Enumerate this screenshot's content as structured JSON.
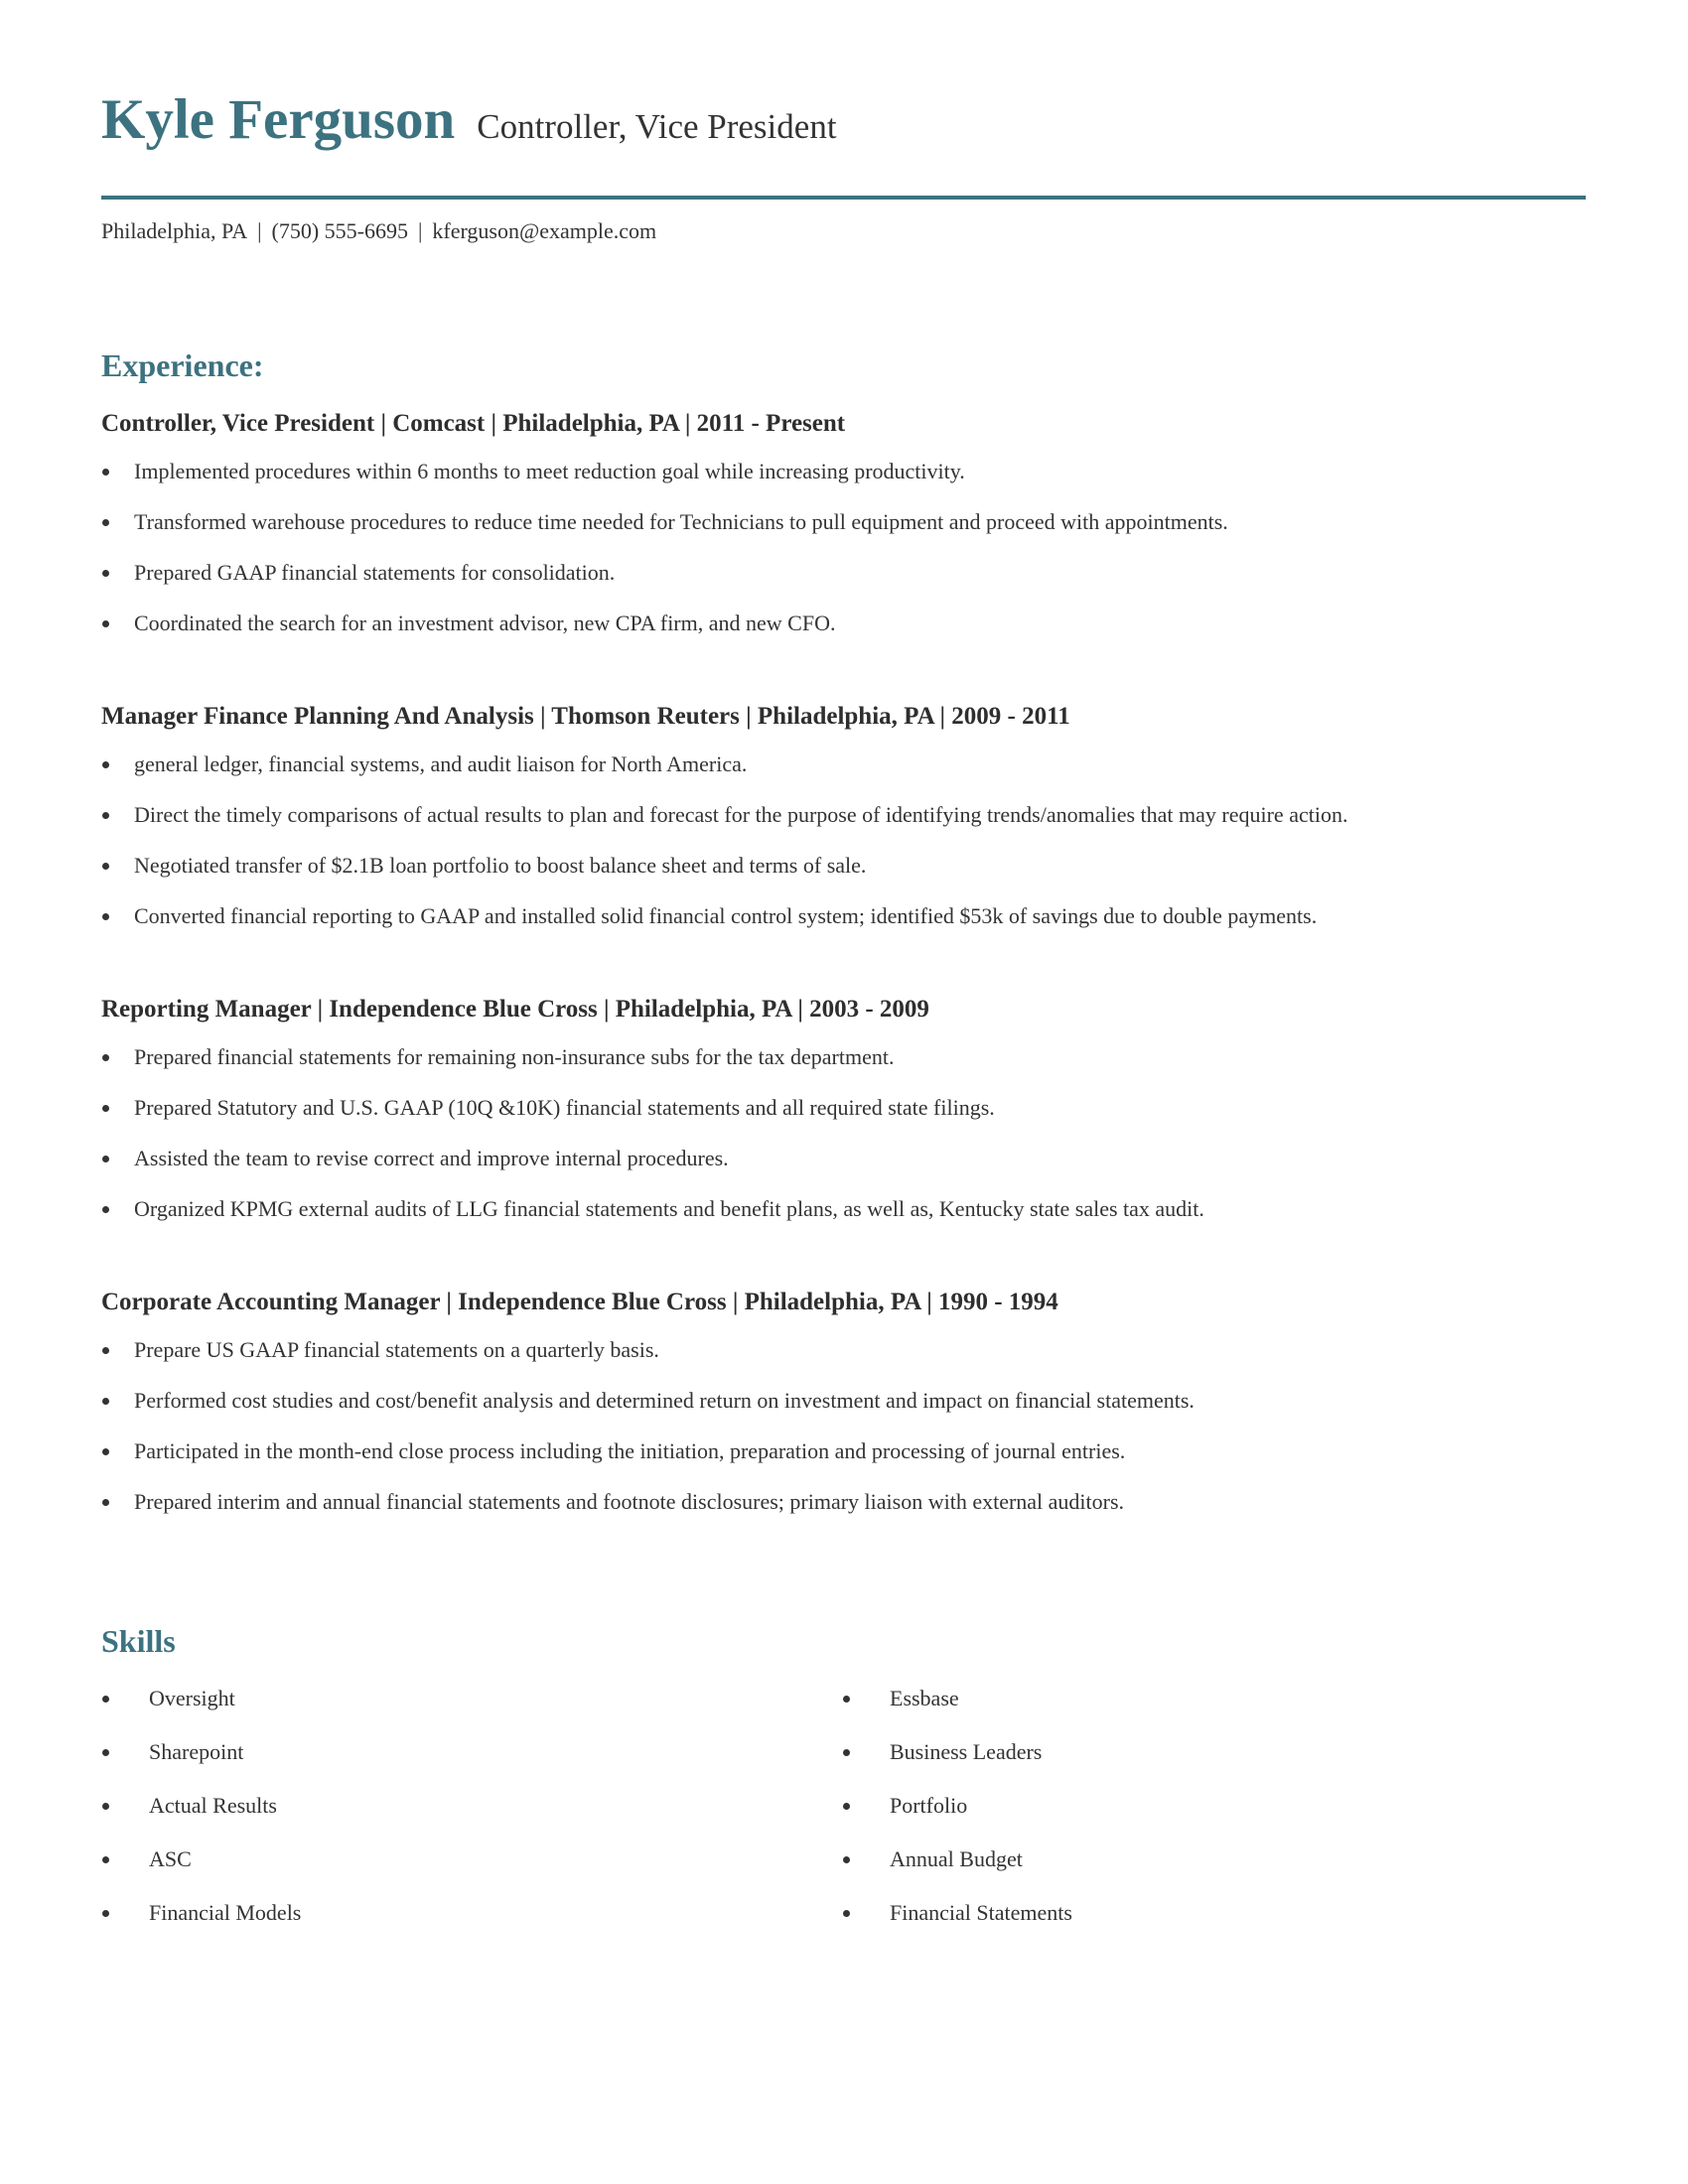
{
  "header": {
    "name": "Kyle Ferguson",
    "title": "Controller, Vice President"
  },
  "contact": {
    "location": "Philadelphia, PA",
    "phone": "(750) 555-6695",
    "email": "kferguson@example.com",
    "separator": "|"
  },
  "colors": {
    "accent": "#3d7280",
    "text": "#333333",
    "heading_text": "#2e2e2e"
  },
  "experience": {
    "heading": "Experience:",
    "jobs": [
      {
        "heading": "Controller, Vice President | Comcast | Philadelphia, PA |  2011 - Present",
        "bullets": [
          "Implemented procedures within 6 months to meet reduction goal while increasing productivity.",
          "Transformed warehouse procedures to reduce time needed for Technicians to pull equipment and proceed with appointments.",
          "Prepared GAAP financial statements for consolidation.",
          "Coordinated the search for an investment advisor, new CPA firm, and new CFO."
        ]
      },
      {
        "heading": "Manager Finance Planning And Analysis | Thomson Reuters | Philadelphia, PA |  2009 - 2011",
        "bullets": [
          "general ledger, financial systems, and audit liaison for North America.",
          "Direct the timely comparisons of actual results to plan and forecast for the purpose of identifying trends/anomalies that may require action.",
          "Negotiated transfer of $2.1B loan portfolio to boost balance sheet and terms of sale.",
          "Converted financial reporting to GAAP and installed solid financial control system; identified $53k of savings due to double payments."
        ]
      },
      {
        "heading": "Reporting Manager | Independence Blue Cross | Philadelphia, PA |  2003 - 2009",
        "bullets": [
          "Prepared financial statements for remaining non-insurance subs for the tax department.",
          "Prepared Statutory and U.S. GAAP (10Q &10K) financial statements and all required state filings.",
          "Assisted the team to revise correct and improve internal procedures.",
          "Organized KPMG external audits of LLG financial statements and benefit plans, as well as, Kentucky state sales tax audit."
        ]
      },
      {
        "heading": "Corporate Accounting Manager | Independence Blue Cross | Philadelphia, PA |  1990 - 1994",
        "bullets": [
          "Prepare US GAAP financial statements on a quarterly basis.",
          "Performed cost studies and cost/benefit analysis and determined return on investment and impact on financial statements.",
          "Participated in the month-end close process including the initiation, preparation and processing of journal entries.",
          "Prepared interim and annual financial statements and footnote disclosures; primary liaison with external auditors."
        ]
      }
    ]
  },
  "skills": {
    "heading": "Skills",
    "left": [
      "Oversight",
      "Sharepoint",
      "Actual Results",
      "ASC",
      "Financial Models"
    ],
    "right": [
      "Essbase",
      "Business Leaders",
      "Portfolio",
      "Annual Budget",
      "Financial Statements"
    ]
  }
}
